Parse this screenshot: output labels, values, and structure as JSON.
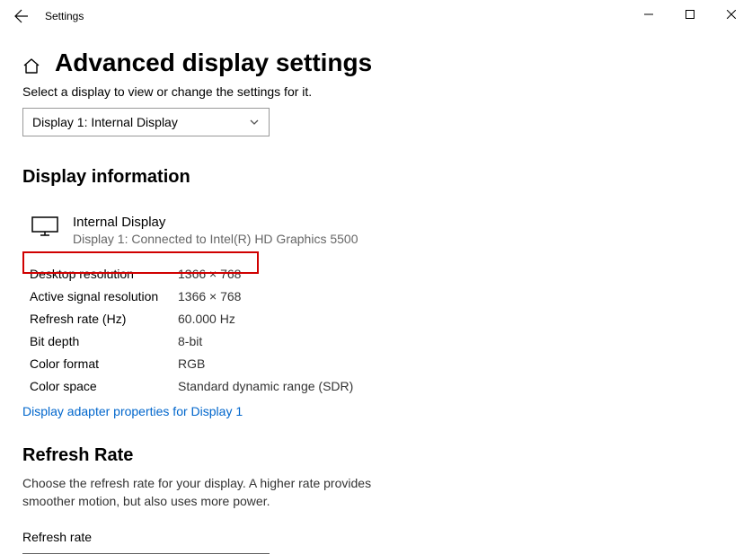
{
  "window": {
    "title": "Settings"
  },
  "page": {
    "title": "Advanced display settings",
    "subtitle": "Select a display to view or change the settings for it.",
    "dropdown_selected": "Display 1: Internal Display"
  },
  "section_info": {
    "heading": "Display information",
    "display_name": "Internal Display",
    "display_sub": "Display 1: Connected to Intel(R) HD Graphics 5500",
    "rows": [
      {
        "label": "Desktop resolution",
        "value": "1366 × 768"
      },
      {
        "label": "Active signal resolution",
        "value": "1366 × 768"
      },
      {
        "label": "Refresh rate (Hz)",
        "value": "60.000 Hz"
      },
      {
        "label": "Bit depth",
        "value": "8-bit"
      },
      {
        "label": "Color format",
        "value": "RGB"
      },
      {
        "label": "Color space",
        "value": "Standard dynamic range (SDR)"
      }
    ],
    "link": "Display adapter properties for Display 1"
  },
  "section_rr": {
    "heading": "Refresh Rate",
    "desc": "Choose the refresh rate for your display. A higher rate provides smoother motion, but also uses more power.",
    "label": "Refresh rate"
  }
}
